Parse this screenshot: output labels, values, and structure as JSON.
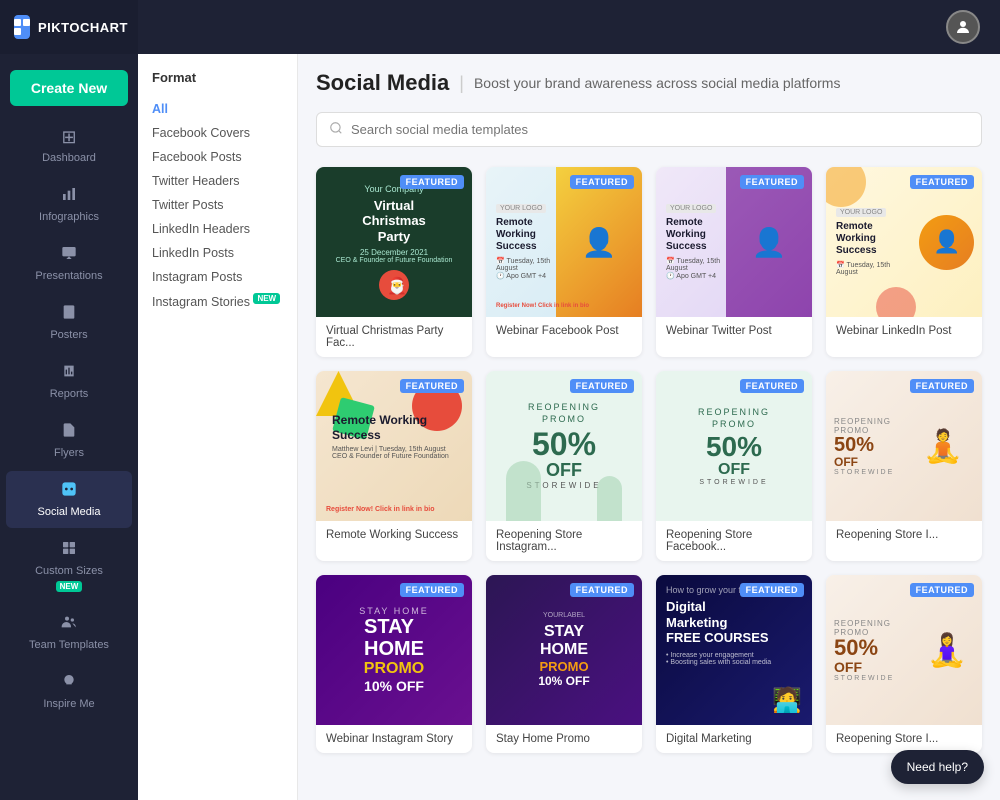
{
  "app": {
    "name": "PIKTOCHART",
    "logo_letter": "P"
  },
  "header": {
    "title": "Social Media",
    "subtitle": "Boost your brand awareness across social media platforms"
  },
  "create_new_label": "Create New",
  "search": {
    "placeholder": "Search social media templates"
  },
  "sidebar": {
    "items": [
      {
        "id": "dashboard",
        "label": "Dashboard",
        "icon": "⊞"
      },
      {
        "id": "infographics",
        "label": "Infographics",
        "icon": "📊"
      },
      {
        "id": "presentations",
        "label": "Presentations",
        "icon": "🖥"
      },
      {
        "id": "posters",
        "label": "Posters",
        "icon": "📌"
      },
      {
        "id": "reports",
        "label": "Reports",
        "icon": "📋"
      },
      {
        "id": "flyers",
        "label": "Flyers",
        "icon": "📄"
      },
      {
        "id": "social-media",
        "label": "Social Media",
        "icon": "📱",
        "active": true
      },
      {
        "id": "custom-sizes",
        "label": "Custom Sizes",
        "icon": "⊡",
        "badge": "NEW"
      },
      {
        "id": "team-templates",
        "label": "Team Templates",
        "icon": "👥"
      },
      {
        "id": "inspire-me",
        "label": "Inspire Me",
        "icon": "💡"
      }
    ]
  },
  "filter": {
    "title": "Format",
    "items": [
      {
        "label": "All",
        "active": true
      },
      {
        "label": "Facebook Covers"
      },
      {
        "label": "Facebook Posts"
      },
      {
        "label": "Twitter Headers"
      },
      {
        "label": "Twitter Posts"
      },
      {
        "label": "LinkedIn Headers"
      },
      {
        "label": "LinkedIn Posts"
      },
      {
        "label": "Instagram Posts"
      },
      {
        "label": "Instagram Stories",
        "badge": "NEW"
      }
    ]
  },
  "templates": [
    {
      "id": "t1",
      "label": "Virtual Christmas Party Fac...",
      "type": "christmas",
      "featured": true
    },
    {
      "id": "t2",
      "label": "Webinar Facebook Post",
      "type": "webinar-fb",
      "featured": true
    },
    {
      "id": "t3",
      "label": "Webinar Twitter Post",
      "type": "webinar-tw",
      "featured": true
    },
    {
      "id": "t4",
      "label": "Webinar LinkedIn Post",
      "type": "webinar-li",
      "featured": true
    },
    {
      "id": "t5",
      "label": "Remote Working Success",
      "type": "remote-insta",
      "featured": true
    },
    {
      "id": "t6",
      "label": "Reopening Store Instagram...",
      "type": "reopen-insta",
      "featured": true
    },
    {
      "id": "t7",
      "label": "Reopening Store Facebook...",
      "type": "reopen-fb",
      "featured": true
    },
    {
      "id": "t8",
      "label": "Reopening Store I...",
      "type": "reopen-store",
      "featured": true
    },
    {
      "id": "t9",
      "label": "Webinar Instagram Story",
      "type": "webinar-insta",
      "featured": true
    },
    {
      "id": "t10",
      "label": "Stay Home Promo",
      "type": "stay-home",
      "featured": true
    },
    {
      "id": "t11",
      "label": "Digital Marketing",
      "type": "digital",
      "featured": true
    },
    {
      "id": "t12",
      "label": "Reopening Store I...",
      "type": "reopen-li",
      "featured": true
    }
  ],
  "need_help": "Need help?"
}
